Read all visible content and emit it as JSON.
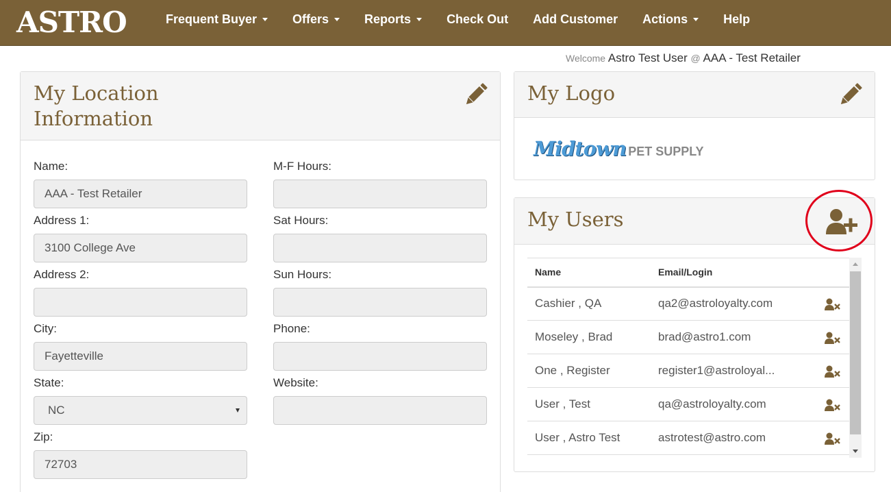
{
  "brand": "ASTRO",
  "nav": {
    "items": [
      {
        "label": "Frequent Buyer",
        "dropdown": true
      },
      {
        "label": "Offers",
        "dropdown": true
      },
      {
        "label": "Reports",
        "dropdown": true
      },
      {
        "label": "Check Out",
        "dropdown": false
      },
      {
        "label": "Add Customer",
        "dropdown": false
      },
      {
        "label": "Actions",
        "dropdown": true
      },
      {
        "label": "Help",
        "dropdown": false
      }
    ]
  },
  "welcome": {
    "prefix": "Welcome",
    "user": "Astro Test User",
    "at": "@",
    "retailer": "AAA - Test Retailer"
  },
  "location": {
    "title_line1": "My Location",
    "title_line2": "Information",
    "fields_left": [
      {
        "label": "Name:",
        "value": "AAA - Test Retailer"
      },
      {
        "label": "Address 1:",
        "value": "3100 College Ave"
      },
      {
        "label": "Address 2:",
        "value": ""
      },
      {
        "label": "City:",
        "value": "Fayetteville"
      },
      {
        "label": "State:",
        "value": "NC"
      },
      {
        "label": "Zip:",
        "value": "72703"
      }
    ],
    "fields_right": [
      {
        "label": "M-F Hours:",
        "value": ""
      },
      {
        "label": "Sat Hours:",
        "value": ""
      },
      {
        "label": "Sun Hours:",
        "value": ""
      },
      {
        "label": "Phone:",
        "value": ""
      },
      {
        "label": "Website:",
        "value": ""
      }
    ]
  },
  "logo": {
    "title": "My Logo",
    "image_text_script": "Midtown",
    "image_text_sub": "PET SUPPLY"
  },
  "users": {
    "title": "My Users",
    "columns": [
      "Name",
      "Email/Login"
    ],
    "rows": [
      {
        "name": "Cashier , QA",
        "email": "qa2@astroloyalty.com"
      },
      {
        "name": "Moseley , Brad",
        "email": "brad@astro1.com"
      },
      {
        "name": "One , Register",
        "email": "register1@astroloyal..."
      },
      {
        "name": "User , Test",
        "email": "qa@astroloyalty.com"
      },
      {
        "name": "User , Astro Test",
        "email": "astrotest@astro.com"
      }
    ]
  },
  "colors": {
    "navbar": "#7a6137",
    "accent": "#7a6137",
    "highlight_circle": "#e0001b"
  }
}
